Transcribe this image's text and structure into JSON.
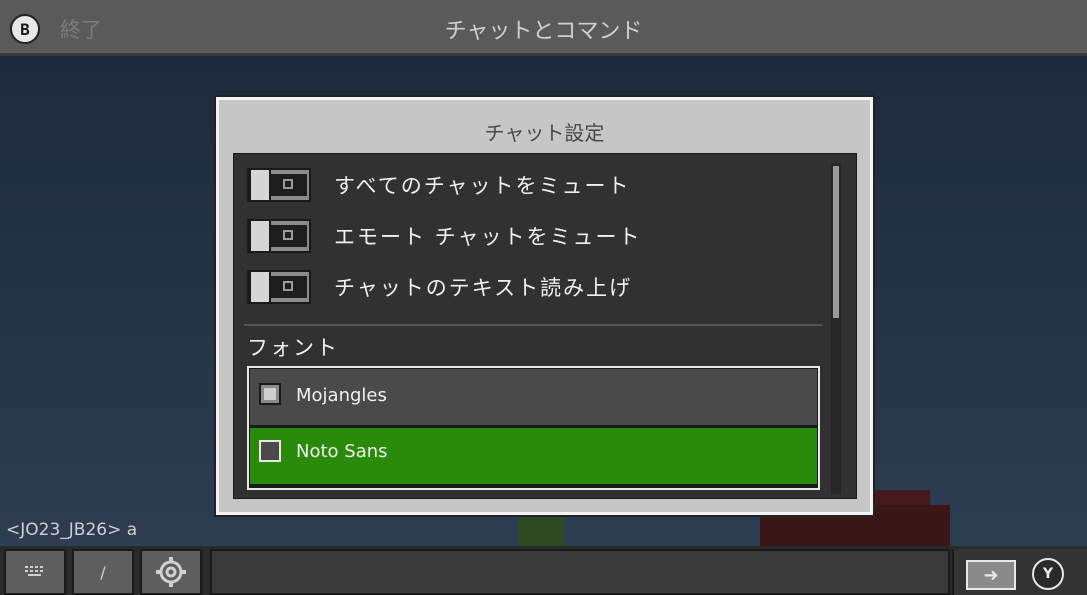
{
  "header": {
    "back_key": "B",
    "back_label": "終了",
    "title": "チャットとコマンド"
  },
  "chat": {
    "last_message": "<JO23_JB26> a"
  },
  "dialog": {
    "title": "チャット設定",
    "toggles": [
      {
        "label": "すべてのチャットをミュート",
        "on": false
      },
      {
        "label": "エモート チャットをミュート",
        "on": false
      },
      {
        "label": "チャットのテキスト読み上げ",
        "on": false
      }
    ],
    "font_section_label": "フォント",
    "fonts": [
      {
        "name": "Mojangles",
        "selected": false
      },
      {
        "name": "Noto Sans",
        "selected": true
      }
    ]
  },
  "bottombar": {
    "keyboard_icon": "keyboard-icon",
    "slash_label": "/",
    "settings_icon": "gear-icon",
    "send_icon": "arrow-right-icon",
    "y_key": "Y"
  },
  "colors": {
    "selected_font_bg": "#2a8a0a",
    "dialog_bg": "#c6c6c6",
    "panel_bg": "#313131"
  }
}
